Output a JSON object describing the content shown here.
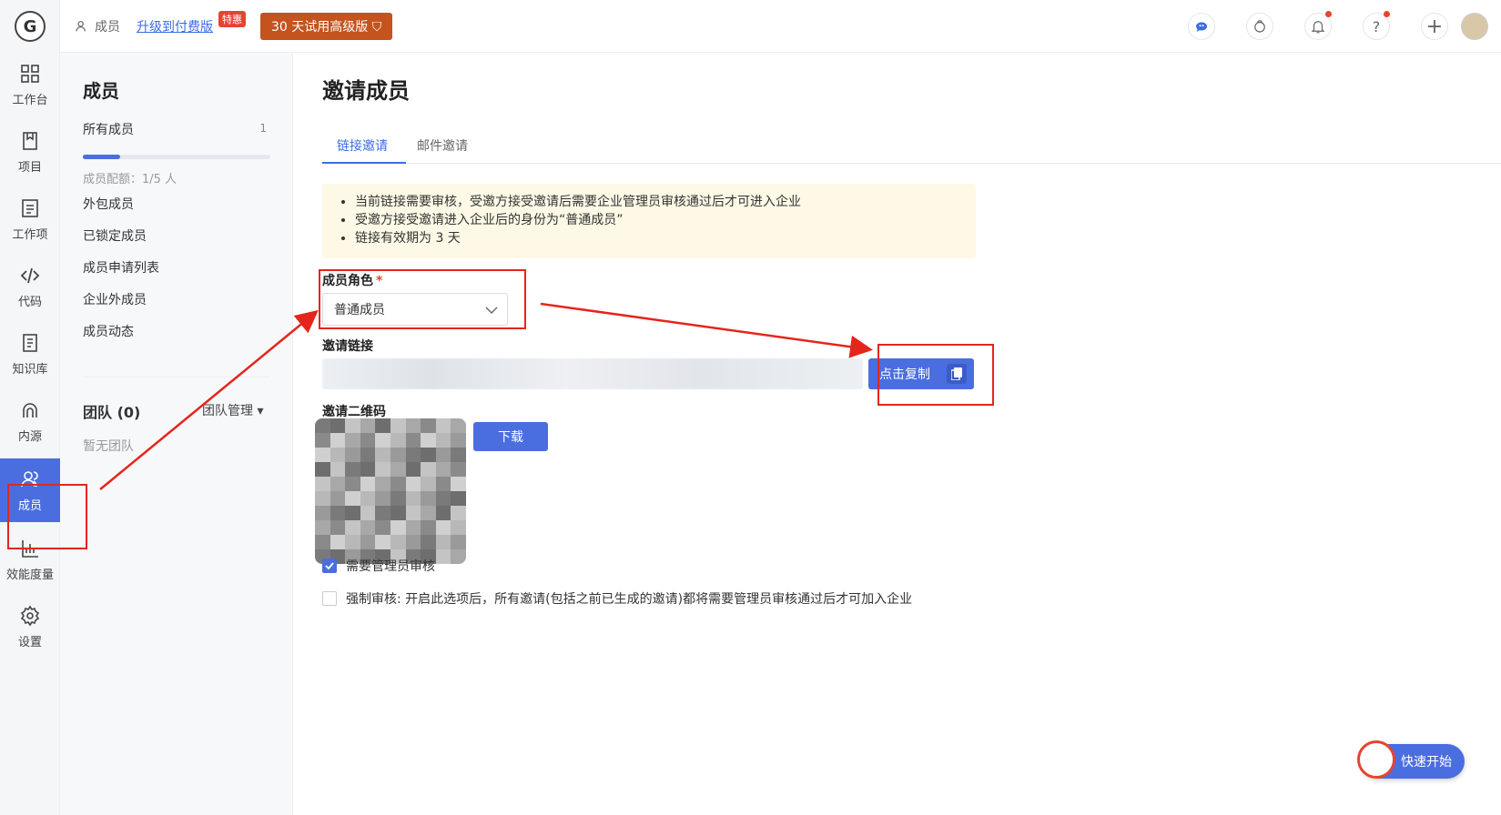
{
  "rail": {
    "logo": "G",
    "items": [
      {
        "label": "工作台",
        "icon": "dashboard-icon"
      },
      {
        "label": "项目",
        "icon": "project-icon"
      },
      {
        "label": "工作项",
        "icon": "task-icon"
      },
      {
        "label": "代码",
        "icon": "code-icon"
      },
      {
        "label": "知识库",
        "icon": "book-icon"
      },
      {
        "label": "内源",
        "icon": "inner-source-icon"
      },
      {
        "label": "成员",
        "icon": "members-icon",
        "active": true
      },
      {
        "label": "效能度量",
        "icon": "chart-icon"
      },
      {
        "label": "设置",
        "icon": "gear-icon"
      }
    ]
  },
  "topbar": {
    "breadcrumb": "成员",
    "upgrade_link": "升级到付费版",
    "special_badge": "特惠",
    "trial_button": "30 天试用高级版 ⛉"
  },
  "panel": {
    "title": "成员",
    "all_members": "所有成员",
    "all_members_count": "1",
    "quota_fraction": 0.2,
    "quota_text": "成员配额：1/5 人",
    "links": [
      "外包成员",
      "已锁定成员",
      "成员申请列表",
      "企业外成员",
      "成员动态"
    ],
    "team_title": "团队 (0)",
    "team_manage": "团队管理 ▾",
    "team_empty": "暂无团队"
  },
  "main": {
    "title": "邀请成员",
    "tabs": [
      "链接邀请",
      "邮件邀请"
    ],
    "notice": [
      "当前链接需要审核，受邀方接受邀请后需要企业管理员审核通过后才可进入企业",
      "受邀方接受邀请进入企业后的身份为“普通成员”",
      "链接有效期为 3 天"
    ],
    "role_label": "成员角色",
    "required_mark": "*",
    "role_value": "普通成员",
    "link_label": "邀请链接",
    "copy_button": "点击复制",
    "qr_label": "邀请二维码",
    "download_button": "下载",
    "require_review_label": "需要管理员审核",
    "require_review_checked": true,
    "force_review_label": "强制审核: 开启此选项后，所有邀请(包括之前已生成的邀请)都将需要管理员审核通过后才可加入企业",
    "force_review_checked": false
  },
  "quick_start": "快速开始",
  "colors": {
    "accent": "#4a6ee0",
    "annotation": "#e5251b",
    "notice_bg": "#fdf9e6",
    "trial_bg": "#c4531e"
  }
}
